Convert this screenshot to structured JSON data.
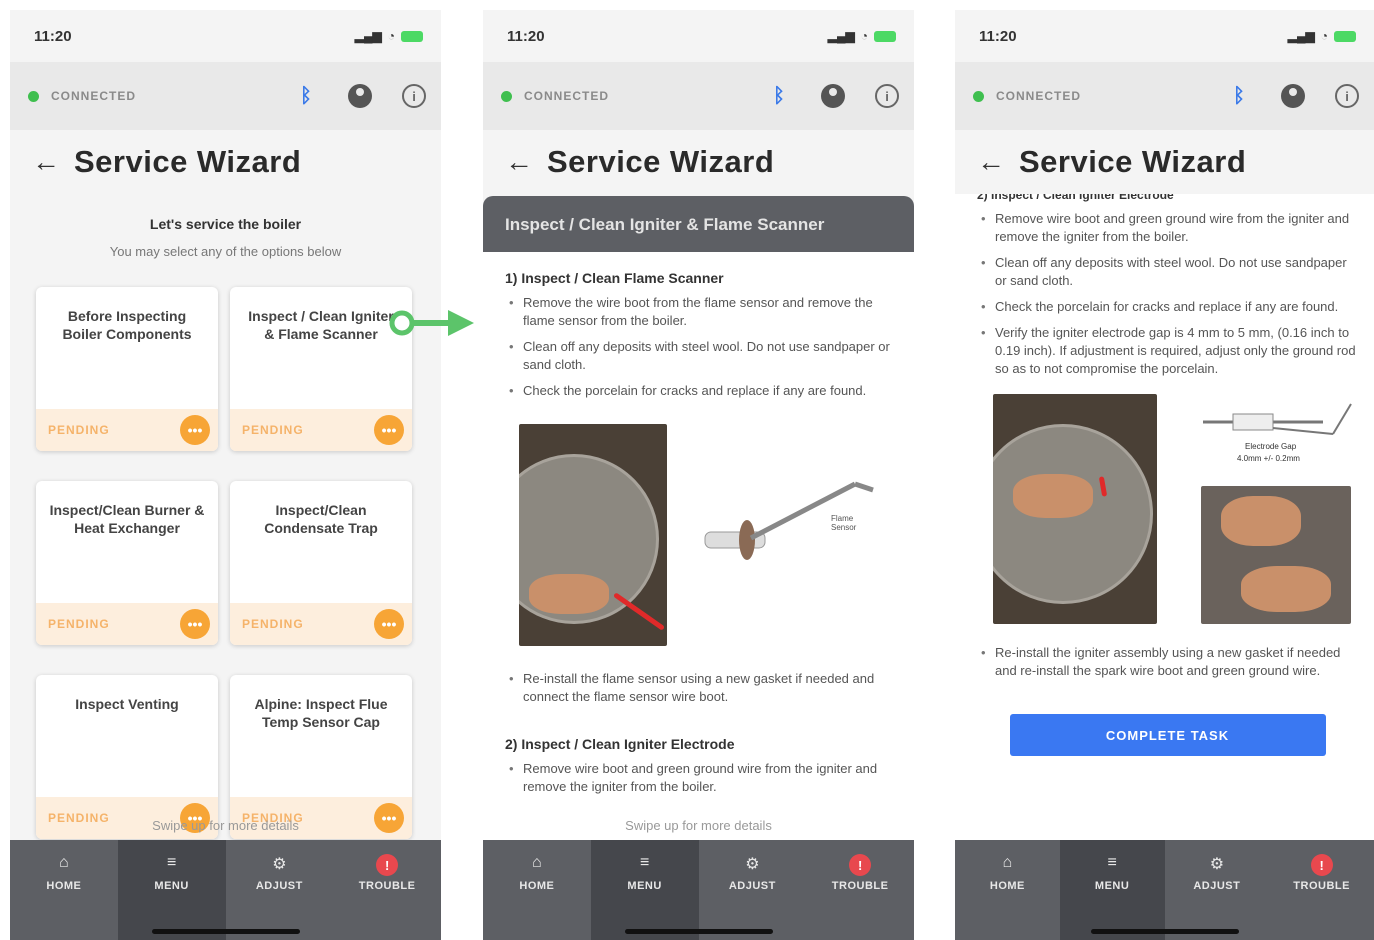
{
  "status_bar": {
    "time": "11:20"
  },
  "connection": {
    "label": "CONNECTED"
  },
  "header": {
    "title": "Service Wizard"
  },
  "menu": {
    "title": "Let's service the boiler",
    "subtitle": "You may select any of the options below",
    "cards": [
      {
        "title": "Before Inspecting Boiler Components",
        "status": "PENDING"
      },
      {
        "title": "Inspect / Clean Igniter & Flame Scanner",
        "status": "PENDING"
      },
      {
        "title": "Inspect/Clean Burner & Heat Exchanger",
        "status": "PENDING"
      },
      {
        "title": "Inspect/Clean Condensate Trap",
        "status": "PENDING"
      },
      {
        "title": "Inspect Venting",
        "status": "PENDING"
      },
      {
        "title": "Alpine: Inspect Flue Temp Sensor Cap",
        "status": "PENDING"
      }
    ],
    "more_label": "•••"
  },
  "detail": {
    "section_title": "Inspect / Clean Igniter & Flame Scanner",
    "step1_title": "1) Inspect / Clean Flame Scanner",
    "step1_bullets": [
      "Remove the wire boot from the flame sensor and remove the flame sensor from the boiler.",
      "Clean off any deposits with steel wool. Do not use sandpaper or sand cloth.",
      "Check the porcelain for cracks and replace if any are found."
    ],
    "step1_after": "Re-install the flame sensor using a new gasket if needed and connect the flame sensor wire boot.",
    "step2_title": "2) Inspect / Clean Igniter Electrode",
    "step2_bullets": [
      "Remove wire boot and green ground wire from the igniter and remove the igniter from the boiler.",
      "Clean off any deposits with steel wool. Do not use sandpaper or sand cloth.",
      "Check the porcelain for cracks and replace if any are found.",
      "Verify the igniter electrode gap is 4 mm to 5 mm, (0.16 inch to 0.19 inch). If adjustment is required, adjust only the ground rod so as to not compromise the porcelain."
    ],
    "step2_after": "Re-install the igniter assembly using a new gasket if needed and re-install the spark wire boot and green ground wire.",
    "flame_sensor_label": "Flame Sensor",
    "electrode_gap_label": "Electrode Gap",
    "electrode_gap_value": "4.0mm +/- 0.2mm",
    "complete_button": "COMPLETE TASK"
  },
  "swipe_hint": "Swipe up for more details",
  "nav": {
    "items": [
      {
        "label": "HOME",
        "icon": "home-icon"
      },
      {
        "label": "MENU",
        "icon": "menu-icon"
      },
      {
        "label": "ADJUST",
        "icon": "gear-icon"
      },
      {
        "label": "TROUBLE",
        "icon": "alert-icon"
      }
    ],
    "trouble_glyph": "!"
  },
  "colors": {
    "accent_blue": "#3a78f2",
    "pending_orange": "#f7a536",
    "connected_green": "#3fbf4f",
    "nav_bg": "#5d5f64",
    "arrow_green": "#5cc46a"
  }
}
